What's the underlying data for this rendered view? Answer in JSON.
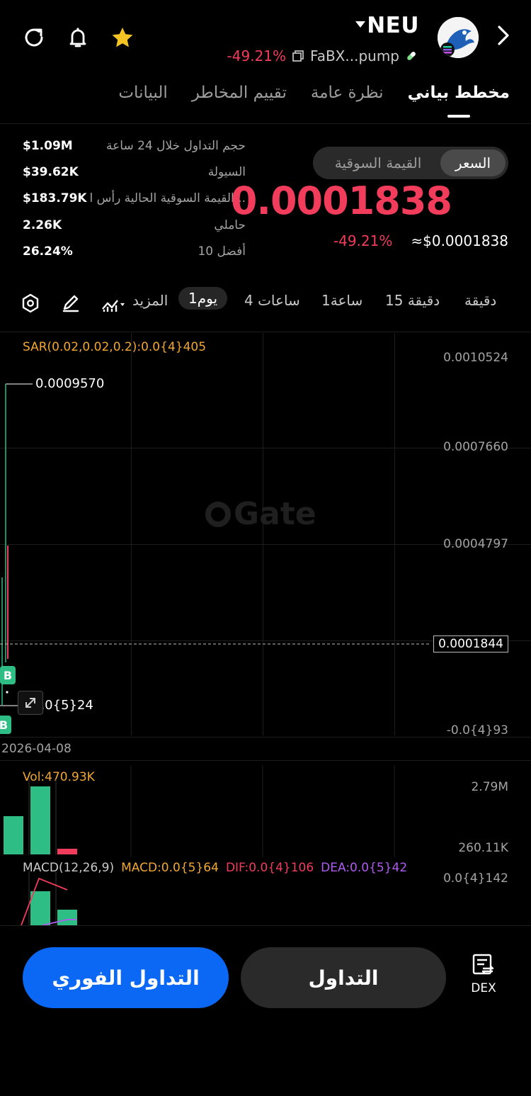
{
  "header": {
    "ticker": "NEU",
    "change_pct": "-49.21%",
    "contract": "FaBX...pump",
    "icons": [
      "refresh-icon",
      "bell-icon",
      "star-icon",
      "chevron-right-icon",
      "copy-icon",
      "pill-icon"
    ]
  },
  "tabs": [
    "مخطط بياني",
    "نظرة عامة",
    "تقييم المخاطر",
    "البيانات"
  ],
  "stats": [
    {
      "label": "حجم التداول خلال 24 ساعة",
      "value": "$1.09M"
    },
    {
      "label": "السيولة",
      "value": "$39.62K"
    },
    {
      "label": "القيمة السوقية الحالية رأس ا...",
      "value": "$183.79K"
    },
    {
      "label": "حاملي",
      "value": "2.26K"
    },
    {
      "label": "أفضل 10",
      "value": "26.24%"
    }
  ],
  "toggle": {
    "price": "السعر",
    "market_cap": "القيمة السوقية"
  },
  "price": {
    "main": "0.0001838",
    "usd": "≈$0.0001838",
    "change": "-49.21%"
  },
  "timeframes": {
    "minute": "دقيقة",
    "m15": "15 دقيقة",
    "h1": "1ساعة",
    "h4": "4 ساعات",
    "d1": "1يوم",
    "more": "المزيد"
  },
  "chart": {
    "sar": "SAR(0.02,0.02,0.2):0.0{4}405",
    "y_labels": [
      "0.0010524",
      "0.0007660",
      "0.0004797",
      "-0.0{4}93"
    ],
    "max_label": "0.0009570",
    "min_label": "0.0{5}24",
    "current": "0.0001844",
    "watermark": "Gate",
    "date": "2026-04-08",
    "buy_marker": "B"
  },
  "volume": {
    "label": "Vol:470.93K",
    "y_top": "2.79M",
    "y_bottom": "260.11K",
    "colors": {
      "up": "#2ebd85",
      "down": "#f23c5b"
    }
  },
  "macd": {
    "name": "MACD(12,26,9)",
    "macd": "MACD:0.0{5}64",
    "dif": "DIF:0.0{4}106",
    "dea": "DEA:0.0{5}42",
    "y_top": "0.0{4}142"
  },
  "buttons": {
    "trade": "التداول",
    "instant": "التداول الفوري",
    "dex": "DEX"
  }
}
